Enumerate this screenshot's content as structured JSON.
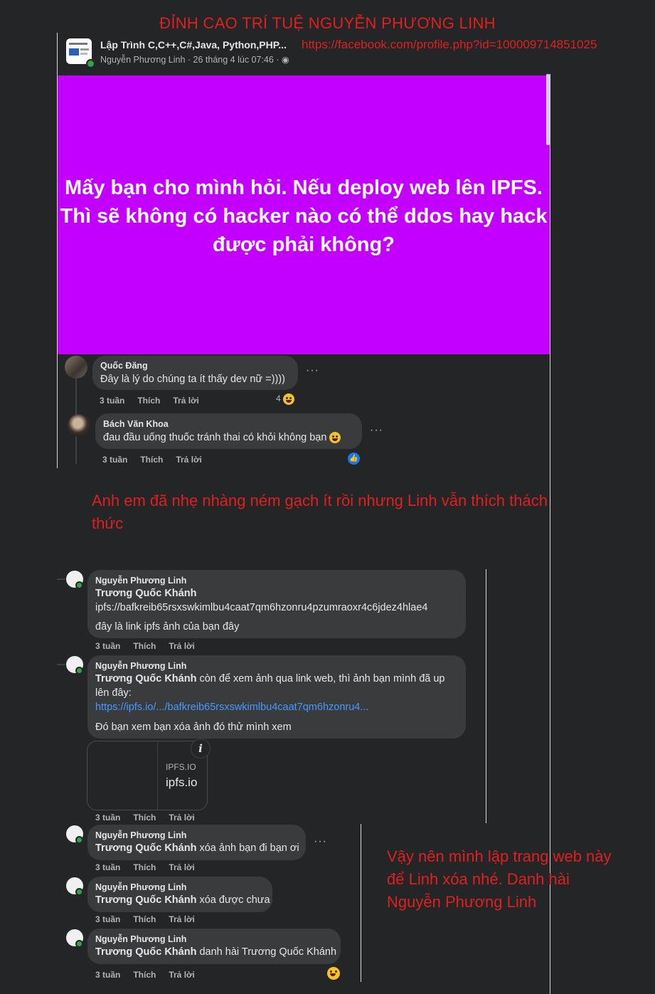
{
  "header": {
    "title": "ĐỈNH CAO TRÍ TUỆ NGUYỄN PHƯƠNG LINH",
    "profile_url": "https://facebook.com/profile.php?id=100009714851025"
  },
  "post": {
    "group_name": "Lập Trình C,C++,C#,Java, Python,PHP...",
    "meta": "Nguyễn Phương Linh · 26 tháng 4 lúc 07:46 · ◉",
    "text": "Mấy bạn cho mình hỏi. Nếu deploy web lên IPFS. Thì sẽ không có hacker nào có thể ddos hay hack được phải không?",
    "background_color": "#c300ff"
  },
  "actions": {
    "time": "3 tuần",
    "like": "Thích",
    "reply": "Trả lời",
    "more": "···"
  },
  "comments_top": [
    {
      "name": "Quốc Đăng",
      "text": "Đây là lý do chúng ta ít thấy dev nữ =))))",
      "reaction_count": "4"
    },
    {
      "name": "Bách Văn Khoa",
      "text": "đau đầu uống thuốc tránh thai có khỏi không bạn"
    }
  ],
  "annotation_1": "Anh em đã nhẹ nhàng ném gạch ít rồi nhưng Linh vẫn thích thách thức",
  "replies": [
    {
      "name": "Nguyễn Phương Linh",
      "tag": "Trương Quốc Khánh",
      "line1": "ipfs://bafkreib65rsxswkimlbu4caat7qm6hzonru4pzumraoxr4c6jdez4hlae4",
      "line2": "đây là link ipfs ảnh của bạn đây"
    },
    {
      "name": "Nguyễn Phương Linh",
      "tag": "Trương Quốc Khánh",
      "text_after_tag": " còn để xem ảnh qua link web, thì ảnh bạn mình đã up",
      "line2": "lên đây:",
      "link": "https://ipfs.io/.../bafkreib65rsxswkimlbu4caat7qm6hzonru4...",
      "line3": "Đó bạn xem bạn xóa ảnh đó thử mình xem",
      "card_domain": "IPFS.IO",
      "card_title": "ipfs.io",
      "info": "i"
    },
    {
      "name": "Nguyễn Phương Linh",
      "tag": "Trương Quốc Khánh",
      "text": " xóa ảnh bạn đi bạn ơi"
    },
    {
      "name": "Nguyễn Phương Linh",
      "tag": "Trương Quốc Khánh",
      "text": " xóa được chưa"
    },
    {
      "name": "Nguyễn Phương Linh",
      "tag": "Trương Quốc Khánh",
      "text": " danh hài Trương Quốc Khánh"
    }
  ],
  "annotation_2": "Vậy nên mình lập trang web này để Linh xóa nhé. Danh hài Nguyễn Phương Linh"
}
